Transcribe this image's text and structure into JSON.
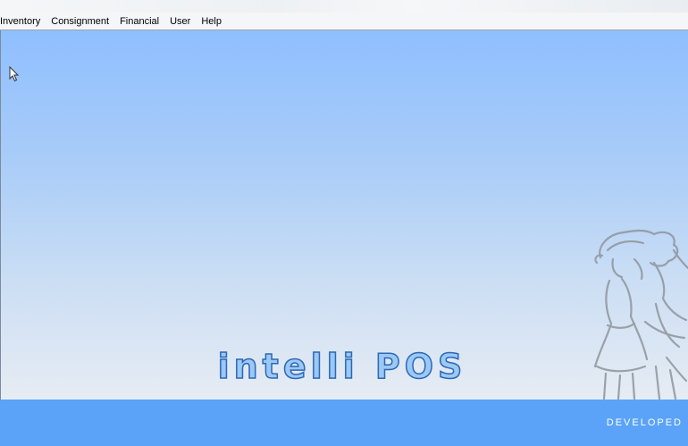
{
  "menu": {
    "items": [
      {
        "label": "Inventory"
      },
      {
        "label": "Consignment"
      },
      {
        "label": "Financial"
      },
      {
        "label": "User"
      },
      {
        "label": "Help"
      }
    ]
  },
  "main": {
    "brand_title": "intelli POS",
    "footer_text": "DEVELOPED"
  },
  "colors": {
    "client_top": "#8fbfff",
    "client_bottom": "#e6ecf3",
    "footer": "#5aa3f8",
    "title_outline": "#2b68b5",
    "title_fill": "#9cc8f5"
  },
  "icons": {
    "cursor": "mouse-pointer-icon",
    "sketch": "girls-sketch-illustration"
  }
}
